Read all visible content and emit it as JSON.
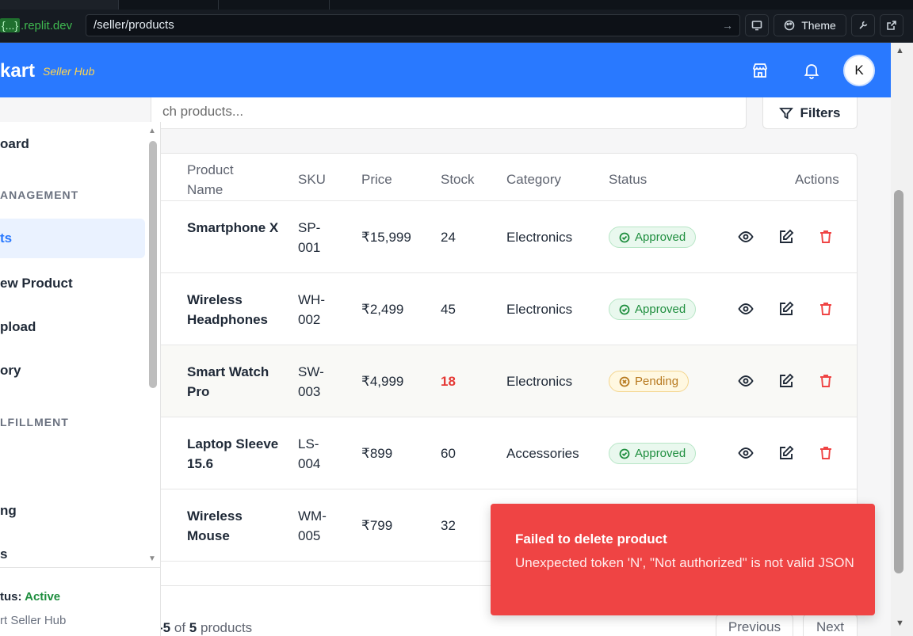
{
  "browser": {
    "host_tag": "{...}",
    "host": ".replit.dev",
    "path": "/seller/products",
    "theme_label": "Theme"
  },
  "header": {
    "logo": "kart",
    "logo_sub": "Seller Hub",
    "avatar_initial": "K"
  },
  "search": {
    "placeholder": "ch products..."
  },
  "filters_label": "Filters",
  "sidebar": {
    "items": [
      {
        "label": "oard",
        "active": false
      },
      {
        "label": "ts",
        "active": true
      },
      {
        "label": "ew Product",
        "active": false
      },
      {
        "label": "pload",
        "active": false
      },
      {
        "label": "ory",
        "active": false
      },
      {
        "label": "ng",
        "active": false
      },
      {
        "label": "s",
        "active": false
      }
    ],
    "sections": [
      "ANAGEMENT",
      "LFILLMENT"
    ],
    "status_label": "tus:",
    "status_value": "Active",
    "brand": "rt Seller Hub"
  },
  "table": {
    "headers": {
      "product_name": "Product Name",
      "sku": "SKU",
      "price": "Price",
      "stock": "Stock",
      "category": "Category",
      "status": "Status",
      "actions": "Actions"
    },
    "rows": [
      {
        "name": "Smartphone X",
        "sku": "SP-001",
        "price": "₹15,999",
        "stock": "24",
        "category": "Electronics",
        "status": "Approved"
      },
      {
        "name": "Wireless Headphones",
        "sku": "WH-002",
        "price": "₹2,499",
        "stock": "45",
        "category": "Electronics",
        "status": "Approved"
      },
      {
        "name": "Smart Watch Pro",
        "sku": "SW-003",
        "price": "₹4,999",
        "stock": "18",
        "category": "Electronics",
        "status": "Pending"
      },
      {
        "name": "Laptop Sleeve 15.6",
        "sku": "LS-004",
        "price": "₹899",
        "stock": "60",
        "category": "Accessories",
        "status": "Approved"
      },
      {
        "name": "Wireless Mouse",
        "sku": "WM-005",
        "price": "₹799",
        "stock": "32",
        "category": "",
        "status": ""
      }
    ]
  },
  "pager": {
    "range": "-5",
    "of": "of",
    "total": "5",
    "unit": "products",
    "prev_label": "Previous",
    "next_label": "Next"
  },
  "toast": {
    "title": "Failed to delete product",
    "message": "Unexpected token 'N', \"Not authorized\" is not valid JSON"
  },
  "colors": {
    "brand": "#2979ff",
    "approved": "#1e8e3e",
    "pending": "#b7791f",
    "danger": "#ef4444"
  }
}
